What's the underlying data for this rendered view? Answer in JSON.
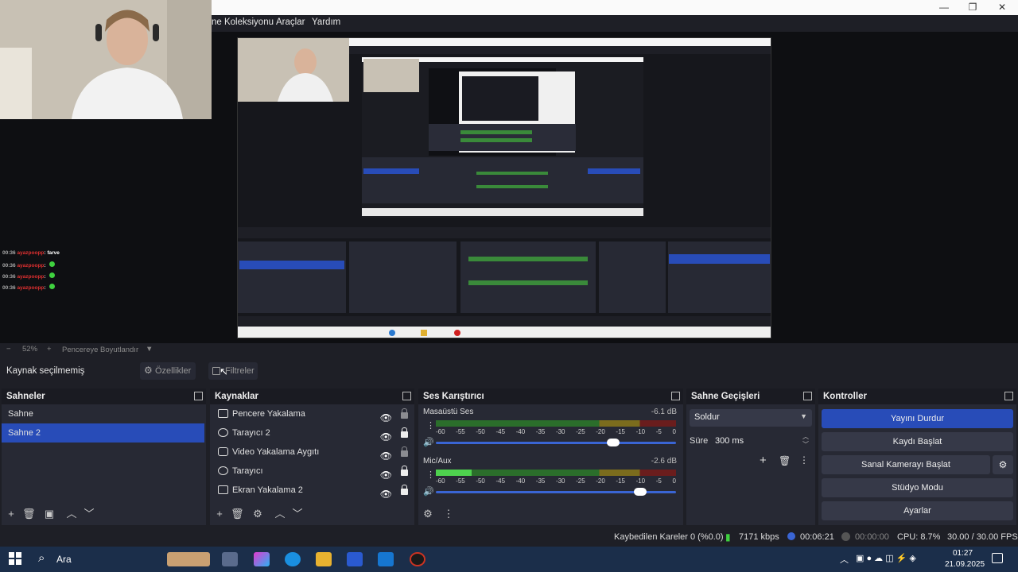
{
  "menu": {
    "items": [
      "ne Koleksiyonu",
      "Araçlar",
      "Yardım"
    ]
  },
  "window_controls": {
    "minimize": "—",
    "maximize": "❐",
    "close": "✕"
  },
  "chat": {
    "user": "ayazpoopp",
    "lines": [
      {
        "time": "00:36",
        "text": ": farve"
      },
      {
        "time": "00:36",
        "text": ": "
      },
      {
        "time": "00:36",
        "text": ": "
      },
      {
        "time": "00:36",
        "text": ": "
      }
    ]
  },
  "zoom": {
    "minus": "−",
    "value": "52%",
    "plus": "+",
    "label": "Pencereye Boyutlandır"
  },
  "sourcebar": {
    "no_source": "Kaynak seçilmemiş",
    "properties": "Özellikler",
    "filters": "Filtreler"
  },
  "scenes": {
    "title": "Sahneler",
    "items": [
      {
        "label": "Sahne"
      },
      {
        "label": "Sahne 2"
      }
    ]
  },
  "sources": {
    "title": "Kaynaklar",
    "items": [
      {
        "label": "Pencere Yakalama",
        "icon": "window-icon"
      },
      {
        "label": "Tarayıcı 2",
        "icon": "globe-icon"
      },
      {
        "label": "Video Yakalama Aygıtı",
        "icon": "camera-icon"
      },
      {
        "label": "Tarayıcı",
        "icon": "globe-icon"
      },
      {
        "label": "Ekran Yakalama 2",
        "icon": "monitor-icon"
      }
    ]
  },
  "mixer": {
    "title": "Ses Karıştırıcı",
    "scale": [
      "-60",
      "-55",
      "-50",
      "-45",
      "-40",
      "-35",
      "-30",
      "-25",
      "-20",
      "-15",
      "-10",
      "-5",
      "0"
    ],
    "channels": [
      {
        "name": "Masaüstü Ses",
        "db": "-6.1 dB",
        "level": 0.0,
        "volume": 0.74
      },
      {
        "name": "Mic/Aux",
        "db": "-2.6 dB",
        "level": 0.15,
        "volume": 0.85
      }
    ]
  },
  "transitions": {
    "title": "Sahne Geçişleri",
    "selected": "Soldur",
    "duration_label": "Süre",
    "duration": "300 ms"
  },
  "controls": {
    "title": "Kontroller",
    "stop_stream": "Yayını Durdur",
    "start_record": "Kaydı Başlat",
    "virtual_cam": "Sanal Kamerayı Başlat",
    "studio_mode": "Stüdyo Modu",
    "settings": "Ayarlar"
  },
  "status": {
    "dropped": "Kaybedilen Kareler 0 (%0.0)",
    "bitrate": "7171 kbps",
    "stream_time": "00:06:21",
    "record_time": "00:00:00",
    "cpu": "CPU: 8.7%",
    "fps": "30.00 / 30.00 FPS"
  },
  "taskbar": {
    "search": "Ara",
    "time": "01:27",
    "date": "21.09.2025"
  },
  "colors": {
    "accent": "#284cb8",
    "dock": "#272934",
    "bg": "#1e1f26",
    "taskbar": "#1b2e4a"
  }
}
